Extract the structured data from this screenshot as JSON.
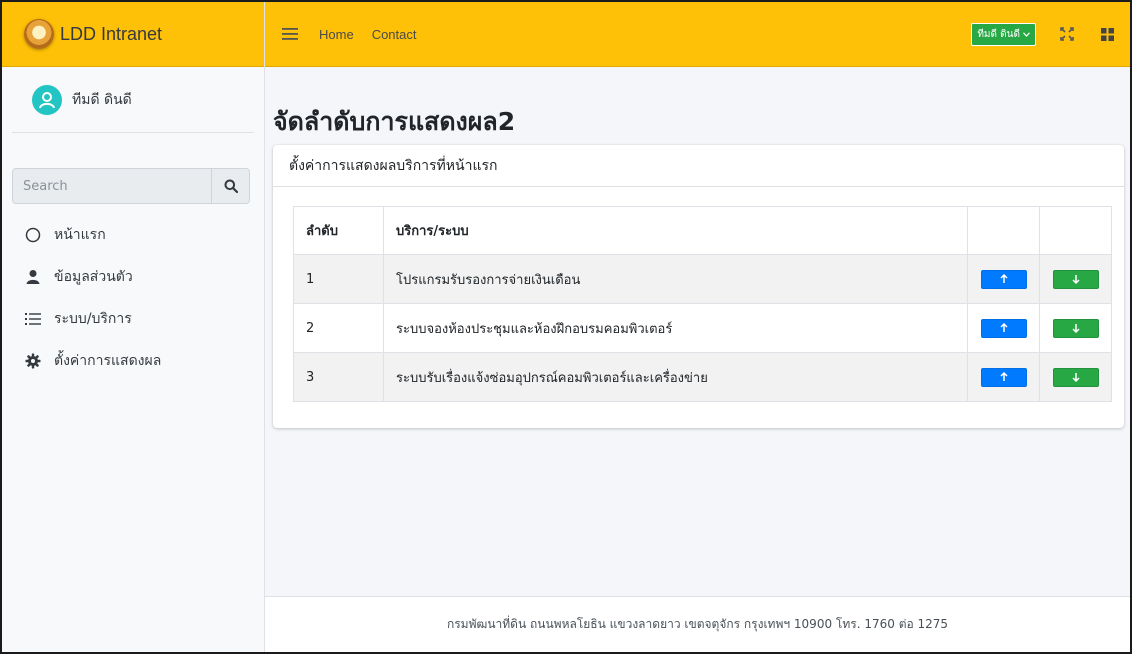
{
  "brand": {
    "name": "LDD Intranet"
  },
  "user": {
    "name": "ทีมดี ดินดี"
  },
  "search": {
    "placeholder": "Search"
  },
  "sidebar": {
    "items": [
      {
        "label": "หน้าแรก",
        "icon": "circle-outline-icon"
      },
      {
        "label": "ข้อมูลส่วนตัว",
        "icon": "user-icon"
      },
      {
        "label": "ระบบ/บริการ",
        "icon": "list-icon"
      },
      {
        "label": "ตั้งค่าการแสดงผล",
        "icon": "gear-icon"
      }
    ]
  },
  "topbar": {
    "home_label": "Home",
    "contact_label": "Contact",
    "user_badge": "ทีมดี ดินดี"
  },
  "page": {
    "title": "จัดลำดับการแสดงผล2",
    "card_title": "ตั้งค่าการแสดงผลบริการที่หน้าแรก"
  },
  "table": {
    "headers": [
      "ลำดับ",
      "บริการ/ระบบ"
    ],
    "rows": [
      {
        "order": "1",
        "service": "โปรแกรมรับรองการจ่ายเงินเดือน"
      },
      {
        "order": "2",
        "service": "ระบบจองห้องประชุมและห้องฝึกอบรมคอมพิวเตอร์"
      },
      {
        "order": "3",
        "service": "ระบบรับเรื่องแจ้งซ่อมอุปกรณ์คอมพิวเตอร์และเครื่องข่าย"
      }
    ]
  },
  "footer": {
    "text": "กรมพัฒนาที่ดิน ถนนพหลโยธิน แขวงลาดยาว เขตจตุจักร กรุงเทพฯ 10900 โทร. 1760 ต่อ 1275"
  },
  "colors": {
    "brand_yellow": "#ffc107",
    "primary": "#007bff",
    "success": "#28a745",
    "avatar": "#22c4c4"
  }
}
